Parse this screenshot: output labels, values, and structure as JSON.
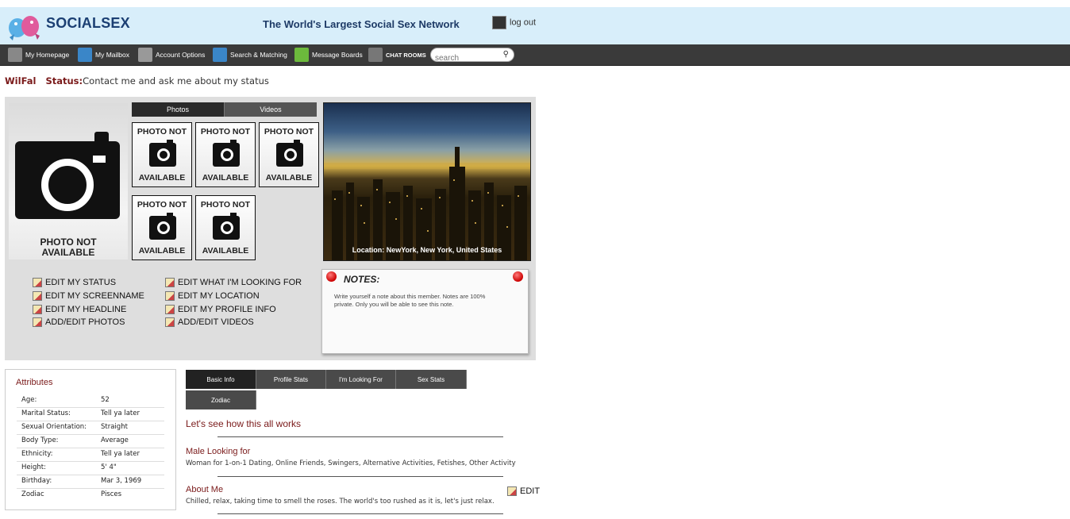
{
  "header": {
    "logo_text": "SOCIALSEX",
    "tagline": "The World's Largest Social Sex Network",
    "logout_label": "log out"
  },
  "nav": {
    "items": [
      {
        "label": "My Homepage",
        "icon": "home-icon"
      },
      {
        "label": "My Mailbox",
        "icon": "mail-icon"
      },
      {
        "label": "Account Options",
        "icon": "gear-icon"
      },
      {
        "label": "Search & Matching",
        "icon": "search-icon"
      },
      {
        "label": "Message Boards",
        "icon": "board-icon"
      },
      {
        "label": "CHAT ROOMS",
        "icon": "chat-icon"
      }
    ],
    "search_placeholder": "search"
  },
  "profile": {
    "username": "WilFal",
    "status_label": "Status:",
    "status_text": "Contact me and ask me about my status"
  },
  "media": {
    "tabs": [
      "Photos",
      "Videos"
    ],
    "main_na_line1": "PHOTO NOT",
    "main_na_line2": "AVAILABLE",
    "thumb_line1": "PHOTO NOT",
    "thumb_line2": "AVAILABLE",
    "location": "Location: NewYork, New York, United States"
  },
  "edit_links": {
    "col1": [
      "EDIT MY STATUS",
      "EDIT MY SCREENNAME",
      "EDIT MY HEADLINE",
      "ADD/EDIT PHOTOS"
    ],
    "col2": [
      "EDIT WHAT I'M LOOKING FOR",
      "EDIT MY LOCATION",
      "EDIT MY PROFILE INFO",
      "ADD/EDIT VIDEOS"
    ]
  },
  "notes": {
    "title": "NOTES:",
    "text": "Write yourself a note about this member. Notes are 100% private. Only you will be able to see this note."
  },
  "attributes": {
    "title": "Attributes",
    "rows": [
      {
        "label": "Age:",
        "value": "52"
      },
      {
        "label": "Marital Status:",
        "value": "Tell ya later"
      },
      {
        "label": "Sexual Orientation:",
        "value": "Straight"
      },
      {
        "label": "Body Type:",
        "value": "Average"
      },
      {
        "label": "Ethnicity:",
        "value": "Tell ya later"
      },
      {
        "label": "Height:",
        "value": "5' 4\""
      },
      {
        "label": "Birthday:",
        "value": "Mar 3, 1969"
      },
      {
        "label": "Zodiac",
        "value": "Pisces"
      }
    ]
  },
  "info_tabs": [
    "Basic Info",
    "Profile Stats",
    "I'm Looking For",
    "Sex Stats",
    "Zodiac"
  ],
  "basic_info": {
    "heading": "Let's see how this all works",
    "looking_title": "Male Looking for",
    "looking_text": "Woman for 1-on-1 Dating, Online Friends, Swingers, Alternative Activities, Fetishes, Other Activity",
    "about_title": "About Me",
    "about_text": "Chilled, relax, taking time to smell the roses. The world's too rushed as it is, let's just relax.",
    "edit_label": "EDIT"
  }
}
